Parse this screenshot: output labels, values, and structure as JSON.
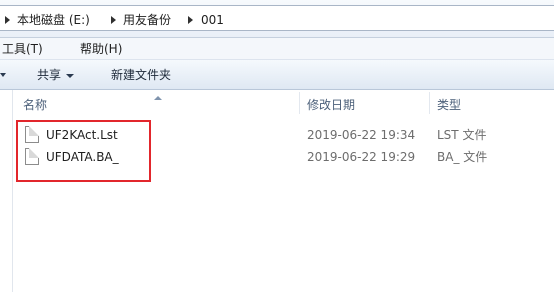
{
  "address": {
    "breadcrumbs": [
      "本地磁盘 (E:)",
      "用友备份",
      "001"
    ]
  },
  "menu": {
    "items": [
      "工具(T)",
      "帮助(H)"
    ]
  },
  "toolbar": {
    "share_label": "共享",
    "new_folder_label": "新建文件夹"
  },
  "columns": {
    "name": "名称",
    "date": "修改日期",
    "type": "类型"
  },
  "files": [
    {
      "name": "UF2KAct.Lst",
      "date": "2019-06-22 19:34",
      "type": "LST 文件"
    },
    {
      "name": "UFDATA.BA_",
      "date": "2019-06-22 19:29",
      "type": "BA_ 文件"
    }
  ],
  "colors": {
    "highlight": "#e2262c",
    "header_text": "#4c607a"
  },
  "icons": [
    "chevron-right-icon",
    "dropdown-arrow-icon",
    "sort-up-icon",
    "file-icon"
  ]
}
